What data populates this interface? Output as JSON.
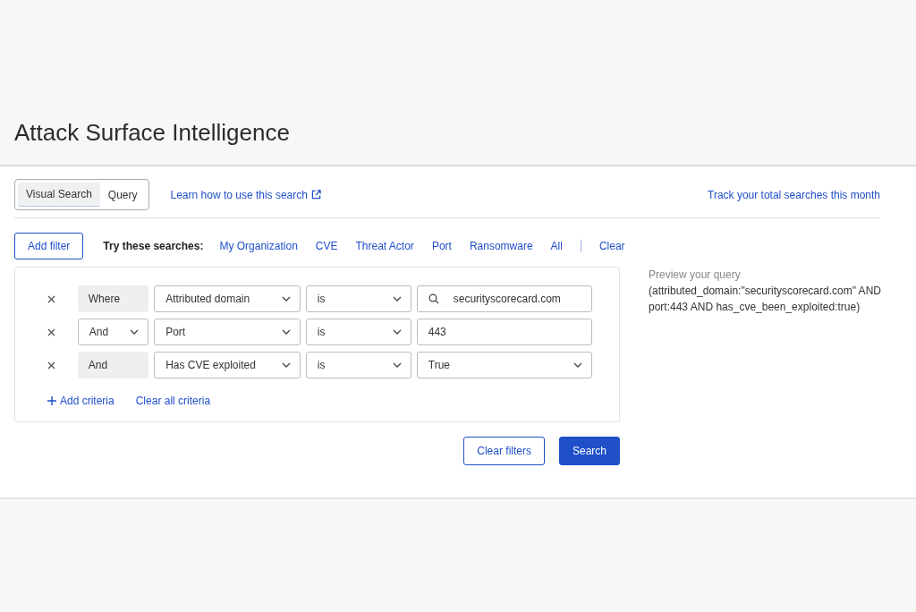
{
  "page_title": "Attack Surface Intelligence",
  "mode_tabs": [
    {
      "label": "Visual Search",
      "selected": true
    },
    {
      "label": "Query",
      "selected": false
    }
  ],
  "help_link": "Learn how to use this search",
  "track_link": "Track your total searches this month",
  "add_filter_button": "Add filter",
  "suggestions_label": "Try these searches:",
  "suggestions": [
    "My Organization",
    "CVE",
    "Threat Actor",
    "Port",
    "Ransomware",
    "All"
  ],
  "clear_link": "Clear",
  "criteria": [
    {
      "connector": {
        "kind": "static",
        "text": "Where"
      },
      "field": "Attributed domain",
      "operator": "is",
      "value": {
        "kind": "search",
        "text": "securityscorecard.com"
      }
    },
    {
      "connector": {
        "kind": "select",
        "text": "And"
      },
      "field": "Port",
      "operator": "is",
      "value": {
        "kind": "text",
        "text": "443"
      }
    },
    {
      "connector": {
        "kind": "static",
        "text": "And"
      },
      "field": "Has CVE exploited",
      "operator": "is",
      "value": {
        "kind": "select",
        "text": "True"
      }
    }
  ],
  "add_criteria": "Add criteria",
  "clear_all_criteria": "Clear all criteria",
  "preview_label": "Preview your query",
  "preview_query": "(attributed_domain:\"securityscorecard.com\" AND port:443 AND has_cve_been_exploited:true)",
  "clear_filters_button": "Clear filters",
  "search_button": "Search"
}
